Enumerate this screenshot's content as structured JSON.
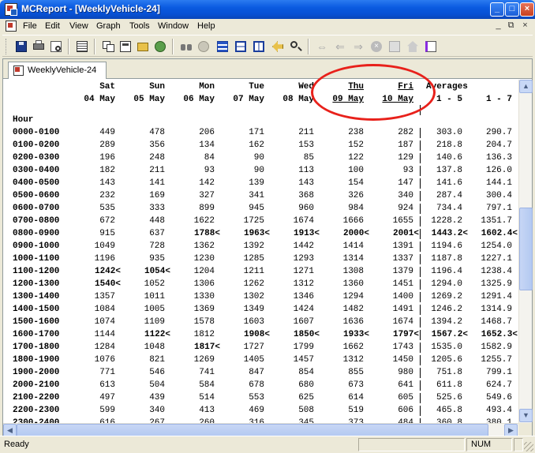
{
  "window": {
    "title": "MCReport - [WeeklyVehicle-24]"
  },
  "menu": {
    "items": [
      {
        "label": "File"
      },
      {
        "label": "Edit"
      },
      {
        "label": "View"
      },
      {
        "label": "Graph"
      },
      {
        "label": "Tools"
      },
      {
        "label": "Window"
      },
      {
        "label": "Help"
      }
    ]
  },
  "toolbar": {
    "icons": [
      "save-icon",
      "print-icon",
      "print-preview-icon",
      "table-icon",
      "copy-report-icon",
      "folder-icon",
      "network-icon",
      "binoculars-icon",
      "filter-icon",
      "multi-window-icon",
      "split-horizontal-icon",
      "split-vertical-icon",
      "back-icon",
      "find-icon",
      "double-arrow-icon",
      "arrow-left-icon",
      "arrow-right-icon",
      "stop-icon",
      "edit-icon",
      "home-icon",
      "book-icon"
    ]
  },
  "tab": {
    "label": "WeeklyVehicle-24"
  },
  "report": {
    "day_headers": [
      {
        "day": "Sat",
        "date": "04 May"
      },
      {
        "day": "Sun",
        "date": "05 May"
      },
      {
        "day": "Mon",
        "date": "06 May"
      },
      {
        "day": "Tue",
        "date": "07 May"
      },
      {
        "day": "Wed",
        "date": "08 May"
      },
      {
        "day": "Thu",
        "date": "09 May"
      },
      {
        "day": "Fri",
        "date": "10 May"
      }
    ],
    "averages_header": "Averages",
    "avg_cols": [
      "1 - 5",
      "1 - 7"
    ],
    "hour_label": "Hour",
    "rows": [
      {
        "hour": "0000-0100",
        "vals": [
          "449",
          "478",
          "206",
          "171",
          "211",
          "238",
          "282"
        ],
        "avg5": "303.0",
        "avg7": "290.7",
        "bold": []
      },
      {
        "hour": "0100-0200",
        "vals": [
          "289",
          "356",
          "134",
          "162",
          "153",
          "152",
          "187"
        ],
        "avg5": "218.8",
        "avg7": "204.7",
        "bold": []
      },
      {
        "hour": "0200-0300",
        "vals": [
          "196",
          "248",
          "84",
          "90",
          "85",
          "122",
          "129"
        ],
        "avg5": "140.6",
        "avg7": "136.3",
        "bold": []
      },
      {
        "hour": "0300-0400",
        "vals": [
          "182",
          "211",
          "93",
          "90",
          "113",
          "100",
          "93"
        ],
        "avg5": "137.8",
        "avg7": "126.0",
        "bold": []
      },
      {
        "hour": "0400-0500",
        "vals": [
          "143",
          "141",
          "142",
          "139",
          "143",
          "154",
          "147"
        ],
        "avg5": "141.6",
        "avg7": "144.1",
        "bold": []
      },
      {
        "hour": "0500-0600",
        "vals": [
          "232",
          "169",
          "327",
          "341",
          "368",
          "326",
          "340"
        ],
        "avg5": "287.4",
        "avg7": "300.4",
        "bold": []
      },
      {
        "hour": "0600-0700",
        "vals": [
          "535",
          "333",
          "899",
          "945",
          "960",
          "984",
          "924"
        ],
        "avg5": "734.4",
        "avg7": "797.1",
        "bold": []
      },
      {
        "hour": "0700-0800",
        "vals": [
          "672",
          "448",
          "1622",
          "1725",
          "1674",
          "1666",
          "1655"
        ],
        "avg5": "1228.2",
        "avg7": "1351.7",
        "bold": []
      },
      {
        "hour": "0800-0900",
        "vals": [
          "915",
          "637",
          "1788<",
          "1963<",
          "1913<",
          "2000<",
          "2001<"
        ],
        "avg5": "1443.2<",
        "avg7": "1602.4<",
        "bold": [
          2,
          3,
          4,
          5,
          6,
          7,
          8
        ]
      },
      {
        "hour": "0900-1000",
        "vals": [
          "1049",
          "728",
          "1362",
          "1392",
          "1442",
          "1414",
          "1391"
        ],
        "avg5": "1194.6",
        "avg7": "1254.0",
        "bold": []
      },
      {
        "hour": "1000-1100",
        "vals": [
          "1196",
          "935",
          "1230",
          "1285",
          "1293",
          "1314",
          "1337"
        ],
        "avg5": "1187.8",
        "avg7": "1227.1",
        "bold": []
      },
      {
        "hour": "1100-1200",
        "vals": [
          "1242<",
          "1054<",
          "1204",
          "1211",
          "1271",
          "1308",
          "1379"
        ],
        "avg5": "1196.4",
        "avg7": "1238.4",
        "bold": [
          0,
          1
        ]
      },
      {
        "hour": "1200-1300",
        "vals": [
          "1540<",
          "1052",
          "1306",
          "1262",
          "1312",
          "1360",
          "1451"
        ],
        "avg5": "1294.0",
        "avg7": "1325.9",
        "bold": [
          0
        ]
      },
      {
        "hour": "1300-1400",
        "vals": [
          "1357",
          "1011",
          "1330",
          "1302",
          "1346",
          "1294",
          "1400"
        ],
        "avg5": "1269.2",
        "avg7": "1291.4",
        "bold": []
      },
      {
        "hour": "1400-1500",
        "vals": [
          "1084",
          "1005",
          "1369",
          "1349",
          "1424",
          "1482",
          "1491"
        ],
        "avg5": "1246.2",
        "avg7": "1314.9",
        "bold": []
      },
      {
        "hour": "1500-1600",
        "vals": [
          "1074",
          "1109",
          "1578",
          "1603",
          "1607",
          "1636",
          "1674"
        ],
        "avg5": "1394.2",
        "avg7": "1468.7",
        "bold": []
      },
      {
        "hour": "1600-1700",
        "vals": [
          "1144",
          "1122<",
          "1812",
          "1908<",
          "1850<",
          "1933<",
          "1797<"
        ],
        "avg5": "1567.2<",
        "avg7": "1652.3<",
        "bold": [
          1,
          3,
          4,
          5,
          6,
          7,
          8
        ]
      },
      {
        "hour": "1700-1800",
        "vals": [
          "1284",
          "1048",
          "1817<",
          "1727",
          "1799",
          "1662",
          "1743"
        ],
        "avg5": "1535.0",
        "avg7": "1582.9",
        "bold": [
          2
        ]
      },
      {
        "hour": "1800-1900",
        "vals": [
          "1076",
          "821",
          "1269",
          "1405",
          "1457",
          "1312",
          "1450"
        ],
        "avg5": "1205.6",
        "avg7": "1255.7",
        "bold": []
      },
      {
        "hour": "1900-2000",
        "vals": [
          "771",
          "546",
          "741",
          "847",
          "854",
          "855",
          "980"
        ],
        "avg5": "751.8",
        "avg7": "799.1",
        "bold": []
      },
      {
        "hour": "2000-2100",
        "vals": [
          "613",
          "504",
          "584",
          "678",
          "680",
          "673",
          "641"
        ],
        "avg5": "611.8",
        "avg7": "624.7",
        "bold": []
      },
      {
        "hour": "2100-2200",
        "vals": [
          "497",
          "439",
          "514",
          "553",
          "625",
          "614",
          "605"
        ],
        "avg5": "525.6",
        "avg7": "549.6",
        "bold": []
      },
      {
        "hour": "2200-2300",
        "vals": [
          "599",
          "340",
          "413",
          "469",
          "508",
          "519",
          "606"
        ],
        "avg5": "465.8",
        "avg7": "493.4",
        "bold": []
      },
      {
        "hour": "2300-2400",
        "vals": [
          "616",
          "267",
          "260",
          "316",
          "345",
          "373",
          "484"
        ],
        "avg5": "360.8",
        "avg7": "380.1",
        "bold": []
      }
    ]
  },
  "annotation": {
    "color": "#e8211b"
  },
  "status": {
    "text": "Ready",
    "num": "NUM"
  }
}
